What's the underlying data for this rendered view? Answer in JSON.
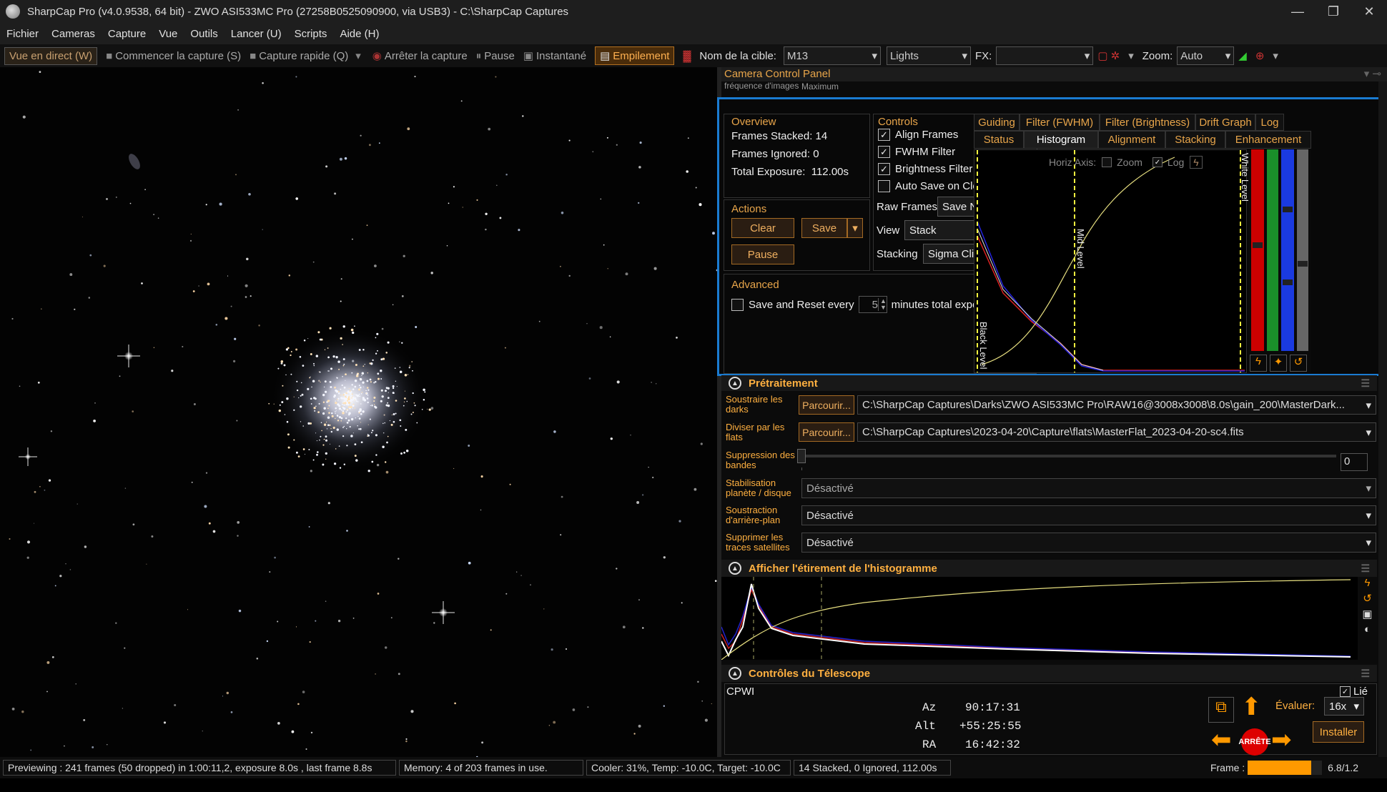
{
  "window": {
    "title": "SharpCap Pro (v4.0.9538, 64 bit) - ZWO ASI533MC Pro (27258B0525090900, via USB3) - C:\\SharpCap Captures",
    "minimize": "—",
    "maximize": "❐",
    "close": "✕"
  },
  "menu": [
    "Fichier",
    "Cameras",
    "Capture",
    "Vue",
    "Outils",
    "Lancer (U)",
    "Scripts",
    "Aide (H)"
  ],
  "toolbar": {
    "live": "Vue en direct (W)",
    "start": "Commencer la capture (S)",
    "quick": "Capture rapide (Q)",
    "stop": "Arrêter la capture",
    "pause": "Pause",
    "snapshot": "Instantané",
    "stack": "Empilement",
    "target_label": "Nom de la cible:",
    "target": "M13",
    "frame_type": "Lights",
    "fx_label": "FX:",
    "fx": "",
    "zoom_label": "Zoom:",
    "zoom": "Auto"
  },
  "panel": {
    "title": "Camera Control Panel",
    "hidden_row": "fréquence d'images",
    "hidden_value": "Maximum"
  },
  "overview": {
    "title": "Overview",
    "stacked_label": "Frames Stacked:",
    "stacked": "14",
    "ignored_label": "Frames Ignored:",
    "ignored": "0",
    "exposure_label": "Total Exposure:",
    "exposure": "112.00s"
  },
  "actions": {
    "title": "Actions",
    "clear": "Clear",
    "save": "Save",
    "pause": "Pause"
  },
  "controls": {
    "title": "Controls",
    "align": "Align Frames",
    "fwhm": "FWHM Filter",
    "brightness": "Brightness Filter",
    "autosave": "Auto Save on Clear/Close",
    "raw_label": "Raw Frames",
    "raw": "Save None",
    "view_label": "View",
    "view": "Stack",
    "stacking_label": "Stacking",
    "stacking": "Sigma Clipping",
    "align_checked": true,
    "fwhm_checked": true,
    "brightness_checked": true,
    "autosave_checked": false
  },
  "advanced": {
    "title": "Advanced",
    "save_reset": "Save and Reset every",
    "minutes": "5",
    "suffix": "minutes total exposure"
  },
  "tabs_top": [
    "Guiding",
    "Filter (FWHM)",
    "Filter (Brightness)",
    "Drift Graph",
    "Log"
  ],
  "tabs_bottom": [
    "Status",
    "Histogram",
    "Alignment",
    "Stacking",
    "Enhancement"
  ],
  "histogram": {
    "horiz_axis": "Horiz Axis:",
    "zoom": "Zoom",
    "log": "Log",
    "black": "Black Level",
    "mid": "Mid Level",
    "white": "White Level"
  },
  "preprocessing": {
    "title": "Prétraitement",
    "rows": [
      {
        "label": "Soustraire les darks",
        "button": "Parcourir...",
        "value": "C:\\SharpCap Captures\\Darks\\ZWO ASI533MC Pro\\RAW16@3008x3008\\8.0s\\gain_200\\MasterDark..."
      },
      {
        "label": "Diviser par les flats",
        "button": "Parcourir...",
        "value": "C:\\SharpCap Captures\\2023-04-20\\Capture\\flats\\MasterFlat_2023-04-20-sc4.fits"
      }
    ],
    "banding_label": "Suppression des bandes",
    "banding_value": "0",
    "selects": [
      {
        "label": "Stabilisation planète / disque",
        "value": "Désactivé"
      },
      {
        "label": "Soustraction d'arrière-plan",
        "value": "Désactivé"
      },
      {
        "label": "Supprimer les traces satellites",
        "value": "Désactivé"
      }
    ]
  },
  "stretch": {
    "title": "Afficher l'étirement de l'histogramme"
  },
  "telescope": {
    "title": "Contrôles du Télescope",
    "mount": "CPWI",
    "linked": "Lié",
    "az_label": "Az",
    "az": "90:17:31",
    "alt_label": "Alt",
    "alt": "+55:25:55",
    "ra_label": "RA",
    "ra": "16:42:32",
    "rate_label": "Évaluer:",
    "rate": "16x",
    "setup": "Installer",
    "stop": "ARRÊTE"
  },
  "status": {
    "preview": "Previewing : 241 frames (50 dropped) in 1:00:11,2, exposure 8.0s , last frame 8.8s",
    "memory": "Memory: 4 of 203 frames in use.",
    "cooler": "Cooler: 31%, Temp: -10.0C, Target: -10.0C",
    "stack": "14 Stacked, 0 Ignored, 112.00s",
    "frame_label": "Frame :",
    "frame_ratio": "6.8/1.2",
    "frame_fill": 0.85
  },
  "colors": {
    "accent": "#e8a54a",
    "highlight": "#1a7bd1",
    "stack_btn": "#ffb050"
  }
}
